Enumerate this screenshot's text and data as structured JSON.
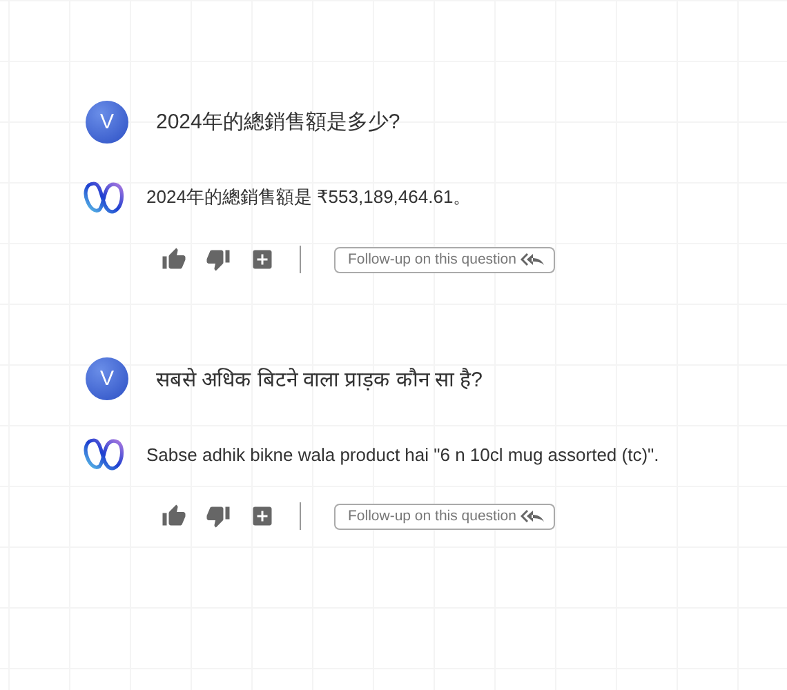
{
  "conversation": [
    {
      "question": {
        "avatar": "V",
        "text": "2024年的總銷售額是多少?"
      },
      "answer": {
        "text": "2024年的總銷售額是 ₹553,189,464.61。"
      },
      "follow_up": "Follow-up on this question"
    },
    {
      "question": {
        "avatar": "V",
        "text": "सबसे अधिक बिटने वाला प्राड़क कौन सा है?"
      },
      "answer": {
        "text": "Sabse adhik bikne wala product hai \"6 n 10cl mug assorted (tc)\"."
      },
      "follow_up": "Follow-up on this question"
    }
  ]
}
